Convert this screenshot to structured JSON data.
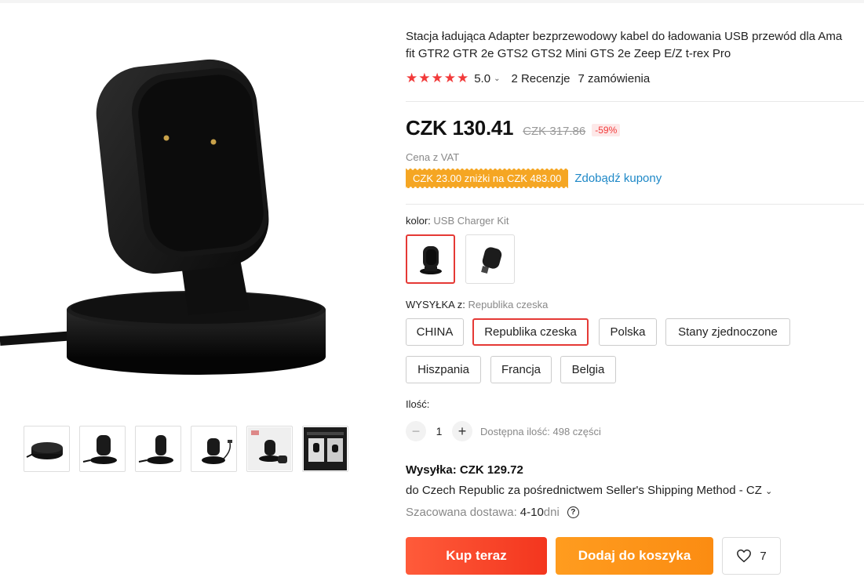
{
  "product": {
    "title_line1": "Stacja ładująca Adapter bezprzewodowy kabel do ładowania USB przewód dla Ama",
    "title_line2": "fit GTR2 GTR 2e GTS2 GTS2 Mini GTS 2e Zeep E/Z t-rex Pro",
    "rating": "5.0",
    "stars": "★★★★★",
    "reviews": "2 Recenzje",
    "orders": "7 zamówienia"
  },
  "price": {
    "current": "CZK 130.41",
    "original": "CZK 317.86",
    "discount": "-59%",
    "vat_note": "Cena z VAT"
  },
  "coupon": {
    "badge": "CZK 23.00 zniżki na CZK 483.00",
    "link": "Zdobądź kupony"
  },
  "color": {
    "label": "kolor:",
    "value": "USB Charger Kit",
    "selected_index": 0,
    "option_count": 2
  },
  "shipping_from": {
    "label": "WYSYŁKA z:",
    "value": "Republika czeska",
    "options": [
      "CHINA",
      "Republika czeska",
      "Polska",
      "Stany zjednoczone",
      "Hiszpania",
      "Francja",
      "Belgia"
    ],
    "selected": "Republika czeska"
  },
  "quantity": {
    "label": "Ilość:",
    "minus": "−",
    "value": "1",
    "plus": "+",
    "available": "Dostępna ilość: 498 części"
  },
  "shipping": {
    "cost": "Wysyłka: CZK 129.72",
    "method": "do Czech Republic za pośrednictwem Seller's Shipping Method - CZ",
    "chevron": "⌄",
    "delivery_label": "Szacowana dostawa:",
    "delivery_value": "4-10",
    "delivery_unit": "dni",
    "help": "?"
  },
  "actions": {
    "buy": "Kup teraz",
    "cart": "Dodaj do koszyka",
    "wishlist_count": "7"
  },
  "thumbnails": [
    "charger-flat",
    "charger-front",
    "charger-side",
    "charger-cable",
    "charger-watch",
    "charger-box"
  ],
  "colors": {
    "accent_red": "#e53935",
    "buy_btn": "#f3361e",
    "cart_btn": "#fb8c12",
    "coupon_bg": "#f5a623",
    "link": "#1e88c7"
  }
}
